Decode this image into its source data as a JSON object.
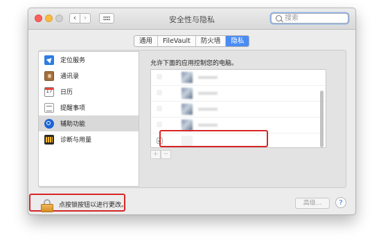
{
  "window": {
    "title": "安全性与隐私"
  },
  "toolbar": {
    "back_glyph": "‹",
    "forward_glyph": "›",
    "search_placeholder": "搜索"
  },
  "tabs": [
    {
      "label": "通用",
      "active": false
    },
    {
      "label": "FileVault",
      "active": false
    },
    {
      "label": "防火墙",
      "active": false
    },
    {
      "label": "隐私",
      "active": true
    }
  ],
  "sidebar": {
    "items": [
      {
        "label": "定位服务",
        "icon": "location-arrow-icon"
      },
      {
        "label": "通讯录",
        "icon": "contacts-book-icon"
      },
      {
        "label": "日历",
        "icon": "calendar-icon",
        "icon_text": "17"
      },
      {
        "label": "提醒事项",
        "icon": "reminders-list-icon"
      },
      {
        "label": "辅助功能",
        "icon": "accessibility-icon",
        "selected": true
      },
      {
        "label": "诊断与用量",
        "icon": "diagnostics-icon"
      }
    ]
  },
  "main": {
    "description": "允许下面的应用控制您的电脑。",
    "app_rows": [
      {
        "checked": false
      },
      {
        "checked": false
      },
      {
        "checked": false
      },
      {
        "checked": false
      },
      {
        "checked": true,
        "check_glyph": "✓"
      }
    ],
    "add_label": "+",
    "remove_label": "−"
  },
  "footer": {
    "lock_text": "点按锁按钮以进行更改。",
    "advanced_label": "高级...",
    "help_label": "?"
  },
  "colors": {
    "accent": "#4a8cf4",
    "highlight_box": "#d62525",
    "lock_body": "#e0a23a"
  }
}
